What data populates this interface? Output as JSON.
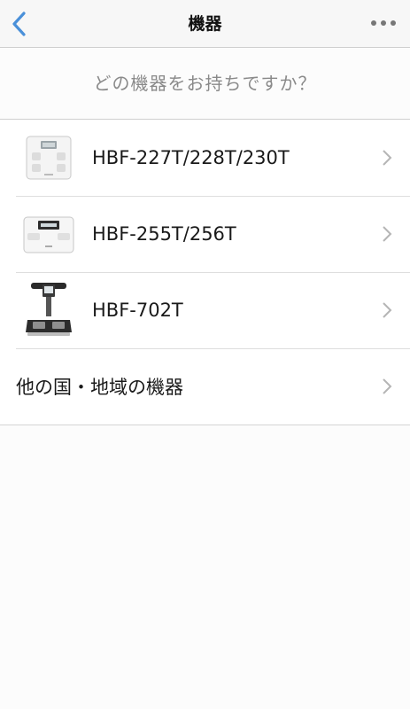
{
  "navbar": {
    "title": "機器",
    "back_icon": "chevron-left-icon",
    "more_icon": "ellipsis-icon",
    "accent_color": "#4a90d9"
  },
  "question": "どの機器をお持ちですか？",
  "devices": [
    {
      "label": "HBF-227T/228T/230T",
      "image": "body-composition-scale-white-icon"
    },
    {
      "label": "HBF-255T/256T",
      "image": "body-composition-scale-wide-icon"
    },
    {
      "label": "HBF-702T",
      "image": "body-composition-monitor-handle-icon"
    }
  ],
  "other_region": {
    "label": "他の国・地域の機器"
  }
}
